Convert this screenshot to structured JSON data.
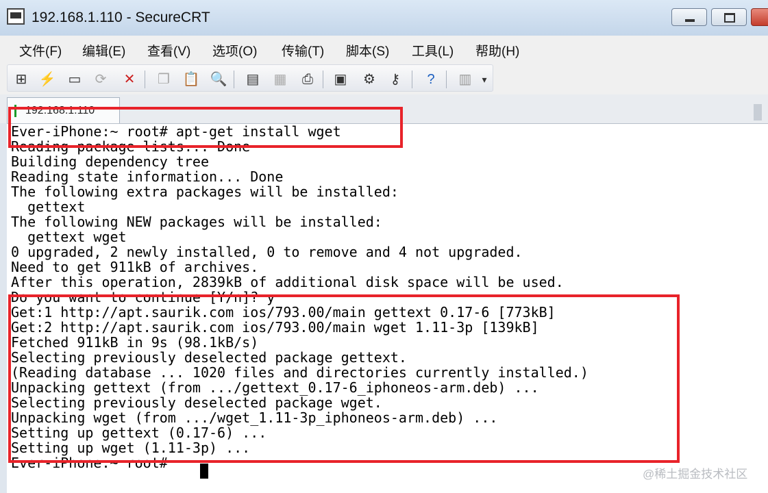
{
  "window": {
    "title": "192.168.1.110 - SecureCRT"
  },
  "menu": [
    "文件(F)",
    "编辑(E)",
    "查看(V)",
    "选项(O)",
    "传输(T)",
    "脚本(S)",
    "工具(L)",
    "帮助(H)"
  ],
  "toolbar": {
    "icons": [
      "connect-icon",
      "quick-connect-icon",
      "connect-tab-icon",
      "reconnect-icon",
      "disconnect-icon",
      "copy-icon",
      "paste-icon",
      "find-icon",
      "print-setup-icon",
      "session-options-icon",
      "print-icon",
      "properties-icon",
      "keymap-icon",
      "key-icon",
      "help-icon",
      "options-icon",
      "toolbar-overflow-icon"
    ]
  },
  "tab": {
    "label": "192.168.1.110",
    "status_color": "#1a9a2a"
  },
  "terminal": {
    "lines": [
      "Ever-iPhone:~ root# apt-get install wget",
      "Reading package lists... Done",
      "Building dependency tree",
      "Reading state information... Done",
      "The following extra packages will be installed:",
      "  gettext",
      "The following NEW packages will be installed:",
      "  gettext wget",
      "0 upgraded, 2 newly installed, 0 to remove and 4 not upgraded.",
      "Need to get 911kB of archives.",
      "After this operation, 2839kB of additional disk space will be used.",
      "Do you want to continue [Y/n]? y",
      "Get:1 http://apt.saurik.com ios/793.00/main gettext 0.17-6 [773kB]",
      "Get:2 http://apt.saurik.com ios/793.00/main wget 1.11-3p [139kB]",
      "Fetched 911kB in 9s (98.1kB/s)",
      "Selecting previously deselected package gettext.",
      "(Reading database ... 1020 files and directories currently installed.)",
      "Unpacking gettext (from .../gettext_0.17-6_iphoneos-arm.deb) ...",
      "Selecting previously deselected package wget.",
      "Unpacking wget (from .../wget_1.11-3p_iphoneos-arm.deb) ...",
      "Setting up gettext (0.17-6) ...",
      "Setting up wget (1.11-3p) ...",
      "Ever-iPhone:~ root# "
    ]
  },
  "highlight_color": "#e8232a",
  "watermark": "@稀土掘金技术社区"
}
